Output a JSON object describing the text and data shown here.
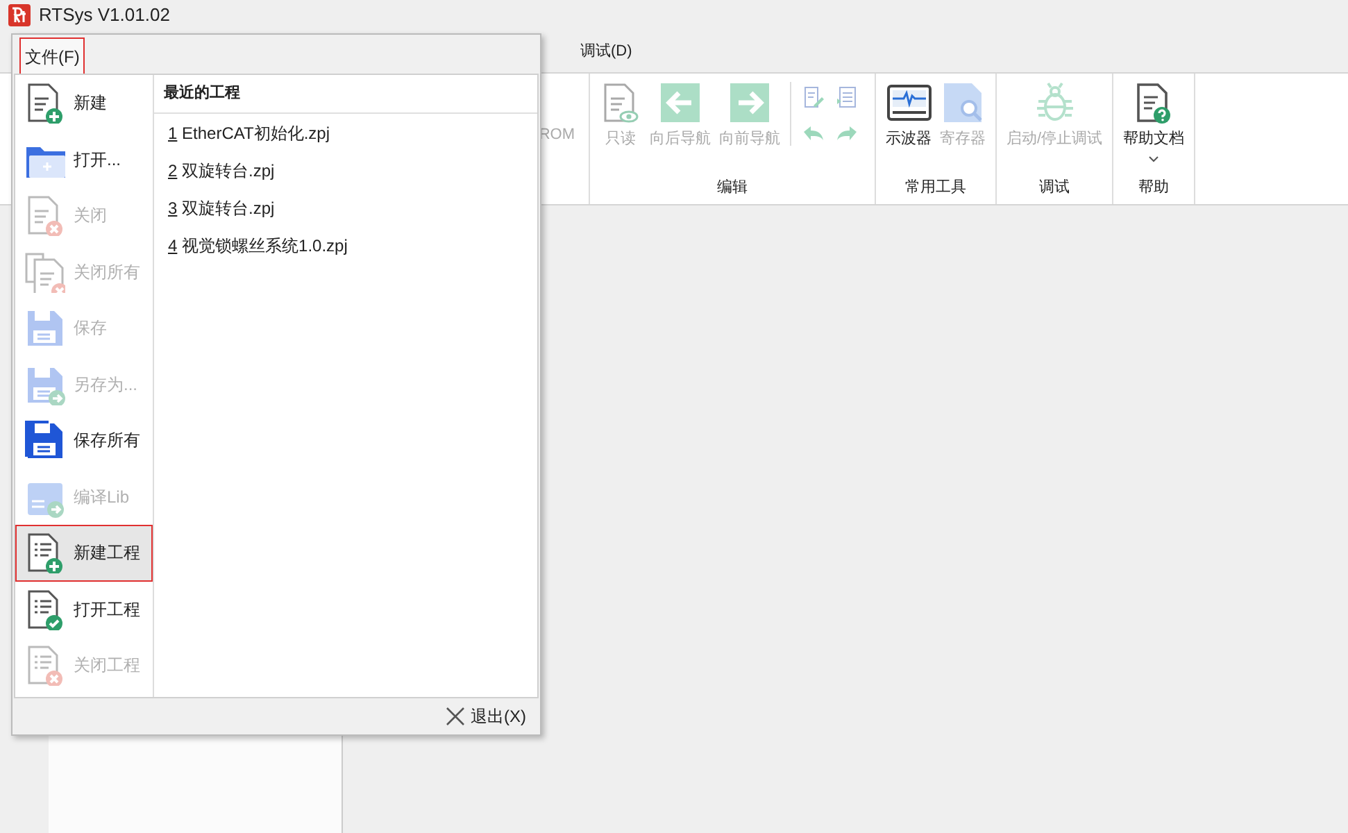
{
  "window": {
    "title": "RTSys V1.01.02"
  },
  "ribbon_tabs": [
    {
      "label": "调试(D)",
      "selected": false
    }
  ],
  "ribbon": {
    "partial_label": "ROM",
    "groups": [
      {
        "label": "编辑",
        "buttons": [
          {
            "kind": "readonly",
            "label": "只读",
            "disabled": true
          },
          {
            "kind": "back",
            "label": "向后导航",
            "disabled": true
          },
          {
            "kind": "forward",
            "label": "向前导航",
            "disabled": true
          },
          {
            "kind": "smalls",
            "disabled": true
          }
        ]
      },
      {
        "label": "常用工具",
        "buttons": [
          {
            "kind": "scope",
            "label": "示波器",
            "disabled": false
          },
          {
            "kind": "register",
            "label": "寄存器",
            "disabled": true
          }
        ]
      },
      {
        "label": "调试",
        "buttons": [
          {
            "kind": "bug",
            "label": "启动/停止调试",
            "disabled": true
          }
        ]
      },
      {
        "label": "帮助",
        "buttons": [
          {
            "kind": "help",
            "label": "帮助文档",
            "disabled": false,
            "dropdown": true
          }
        ]
      }
    ]
  },
  "file_menu": {
    "tab": {
      "label": "文件(F)",
      "highlighted": true
    },
    "items": [
      {
        "kind": "new",
        "label": "新建",
        "disabled": false,
        "highlighted": false
      },
      {
        "kind": "open",
        "label": "打开...",
        "disabled": false,
        "highlighted": false
      },
      {
        "kind": "close",
        "label": "关闭",
        "disabled": true,
        "highlighted": false
      },
      {
        "kind": "close-all",
        "label": "关闭所有",
        "disabled": true,
        "highlighted": false
      },
      {
        "kind": "save",
        "label": "保存",
        "disabled": true,
        "highlighted": false
      },
      {
        "kind": "save-as",
        "label": "另存为...",
        "disabled": true,
        "highlighted": false
      },
      {
        "kind": "save-all",
        "label": "保存所有",
        "disabled": false,
        "highlighted": false
      },
      {
        "kind": "lib",
        "label": "编译Lib",
        "disabled": true,
        "highlighted": false
      },
      {
        "kind": "new-project",
        "label": "新建工程",
        "disabled": false,
        "highlighted": true
      },
      {
        "kind": "open-project",
        "label": "打开工程",
        "disabled": false,
        "highlighted": false
      },
      {
        "kind": "close-project",
        "label": "关闭工程",
        "disabled": true,
        "highlighted": false
      }
    ],
    "recent_title": "最近的工程",
    "recent": [
      {
        "number": "1",
        "name": "EtherCAT初始化.zpj"
      },
      {
        "number": "2",
        "name": "双旋转台.zpj"
      },
      {
        "number": "3",
        "name": "双旋转台.zpj"
      },
      {
        "number": "4",
        "name": "视觉锁螺丝系统1.0.zpj"
      }
    ],
    "exit": {
      "label": "退出(X)"
    }
  }
}
